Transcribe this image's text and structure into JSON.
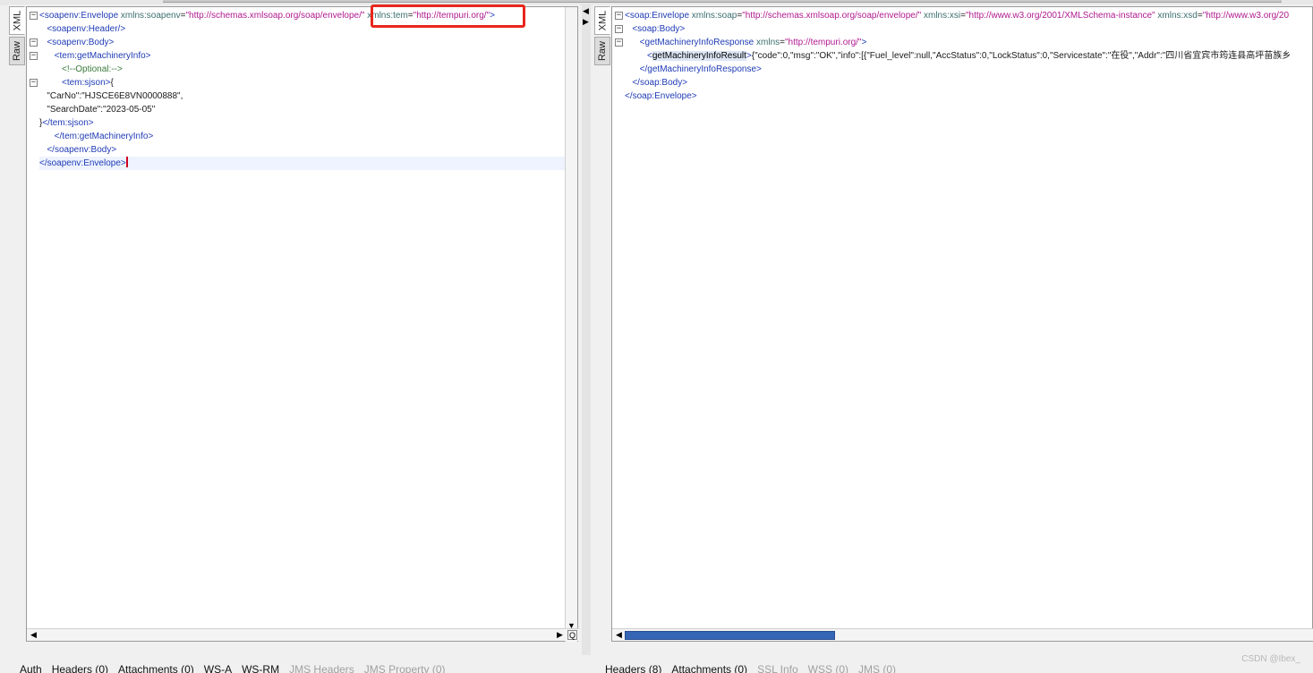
{
  "left_pane": {
    "tabs": [
      "XML",
      "Raw"
    ],
    "lines": [
      {
        "parts": [
          [
            "t",
            "<soapenv:Envelope "
          ],
          [
            "a",
            "xmlns:soapenv"
          ],
          [
            "k",
            "="
          ],
          [
            "v",
            "\"http://schemas.xmlsoap.org/soap/envelope/\""
          ],
          [
            "k",
            " "
          ],
          [
            "a",
            "xmlns:tem"
          ],
          [
            "k",
            "="
          ],
          [
            "v",
            "\"http://tempuri.org/\""
          ],
          [
            "t",
            ">"
          ]
        ]
      },
      {
        "parts": [
          [
            "t",
            "   <soapenv:Header/>"
          ]
        ]
      },
      {
        "parts": [
          [
            "t",
            "   <soapenv:Body>"
          ]
        ]
      },
      {
        "parts": [
          [
            "t",
            "      <tem:getMachineryInfo>"
          ]
        ]
      },
      {
        "parts": [
          [
            "c",
            "         <!--Optional:-->"
          ]
        ]
      },
      {
        "parts": [
          [
            "t",
            "         <tem:sjson>"
          ],
          [
            "k",
            "{"
          ]
        ]
      },
      {
        "parts": [
          [
            "k",
            "   \"CarNo\":\"HJSCE6E8VN0000888\","
          ]
        ]
      },
      {
        "parts": [
          [
            "k",
            "   \"SearchDate\":\"2023-05-05\""
          ]
        ]
      },
      {
        "parts": [
          [
            "k",
            "}"
          ],
          [
            "t",
            "</tem:sjson>"
          ]
        ]
      },
      {
        "parts": [
          [
            "t",
            "      </tem:getMachineryInfo>"
          ]
        ]
      },
      {
        "parts": [
          [
            "t",
            "   </soapenv:Body>"
          ]
        ]
      },
      {
        "parts": [
          [
            "t",
            "</soapenv:Envelope>"
          ]
        ]
      }
    ]
  },
  "right_pane": {
    "tabs": [
      "XML",
      "Raw"
    ],
    "lines": [
      {
        "parts": [
          [
            "t",
            "<soap:Envelope "
          ],
          [
            "a",
            "xmlns:soap"
          ],
          [
            "k",
            "="
          ],
          [
            "v",
            "\"http://schemas.xmlsoap.org/soap/envelope/\""
          ],
          [
            "k",
            " "
          ],
          [
            "a",
            "xmlns:xsi"
          ],
          [
            "k",
            "="
          ],
          [
            "v",
            "\"http://www.w3.org/2001/XMLSchema-instance\""
          ],
          [
            "k",
            " "
          ],
          [
            "a",
            "xmlns:xsd"
          ],
          [
            "k",
            "="
          ],
          [
            "v",
            "\"http://www.w3.org/20"
          ]
        ]
      },
      {
        "parts": [
          [
            "t",
            "   <soap:Body>"
          ]
        ]
      },
      {
        "parts": [
          [
            "t",
            "      <getMachineryInfoResponse "
          ],
          [
            "a",
            "xmlns"
          ],
          [
            "k",
            "="
          ],
          [
            "v",
            "\"http://tempuri.org/\""
          ],
          [
            "t",
            ">"
          ]
        ]
      },
      {
        "parts": [
          [
            "t",
            "         <"
          ],
          [
            "hl",
            "getMachineryInfoResult"
          ],
          [
            "t",
            ">"
          ],
          [
            "k",
            "{\"code\":0,\"msg\":\"OK\",\"info\":[{\"Fuel_level\":null,\"AccStatus\":0,\"LockStatus\":0,\"Servicestate\":\"在役\",\"Addr\":\"四川省宜宾市筠连县高坪苗族乡"
          ]
        ]
      },
      {
        "parts": [
          [
            "t",
            "      </getMachineryInfoResponse>"
          ]
        ]
      },
      {
        "parts": [
          [
            "t",
            "   </soap:Body>"
          ]
        ]
      },
      {
        "parts": [
          [
            "t",
            "</soap:Envelope>"
          ]
        ]
      }
    ]
  },
  "bottom_tabs_left": [
    {
      "label": "Auth",
      "dim": false
    },
    {
      "label": "Headers (0)",
      "dim": false
    },
    {
      "label": "Attachments (0)",
      "dim": false
    },
    {
      "label": "WS-A",
      "dim": false
    },
    {
      "label": "WS-RM",
      "dim": false
    },
    {
      "label": "JMS Headers",
      "dim": true
    },
    {
      "label": "JMS Property (0)",
      "dim": true
    }
  ],
  "bottom_tabs_right": [
    {
      "label": "Headers (8)",
      "dim": false
    },
    {
      "label": "Attachments (0)",
      "dim": false
    },
    {
      "label": "SSL Info",
      "dim": true
    },
    {
      "label": "WSS (0)",
      "dim": true
    },
    {
      "label": "JMS (0)",
      "dim": true
    }
  ],
  "watermark": "CSDN @Ibex_",
  "colors": {
    "tag": "#1f3bb5",
    "attribute": "#3c6e6e",
    "value": "#b01a8f",
    "highlight_box": "#e8261c"
  }
}
